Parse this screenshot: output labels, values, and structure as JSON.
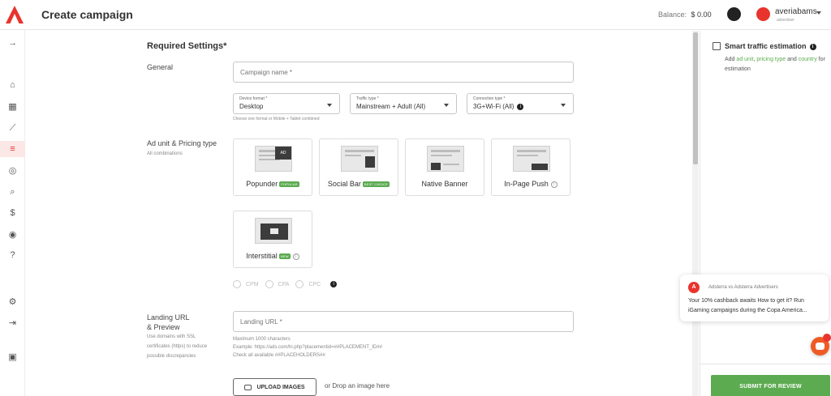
{
  "header": {
    "title": "Create campaign",
    "balance_label": "Balance:",
    "balance_value": "$ 0.00",
    "username": "averiabams",
    "user_role": "advertiser"
  },
  "sidebar": {
    "items": [
      {
        "name": "expand",
        "glyph": "→"
      },
      {
        "name": "academy",
        "glyph": "⌂"
      },
      {
        "name": "dashboard",
        "glyph": "▦"
      },
      {
        "name": "statistics",
        "glyph": "⟋"
      },
      {
        "name": "campaigns",
        "glyph": "≡"
      },
      {
        "name": "explore",
        "glyph": "◎"
      },
      {
        "name": "search",
        "glyph": "⌕"
      },
      {
        "name": "finance",
        "glyph": "$"
      },
      {
        "name": "referral",
        "glyph": "◉"
      },
      {
        "name": "help",
        "glyph": "?"
      },
      {
        "name": "settings",
        "glyph": "⚙"
      },
      {
        "name": "logout",
        "glyph": "⇥"
      },
      {
        "name": "wallet",
        "glyph": "▣"
      }
    ]
  },
  "form": {
    "section_title": "Required Settings*",
    "general_label": "General",
    "campaign_name_placeholder": "Campaign name *",
    "device_format": {
      "label": "Device format *",
      "value": "Desktop"
    },
    "traffic_type": {
      "label": "Traffic type *",
      "value": "Mainstream + Adult (All)"
    },
    "connection_type": {
      "label": "Connection type *",
      "value": "3G+Wi-Fi (All)"
    },
    "device_hint": "Choose one format or Mobile + Tablet combined",
    "ad_unit_label": "Ad unit & Pricing type",
    "ad_unit_sub": "All combinations",
    "ad_units": [
      {
        "name": "Popunder",
        "badge": "POPULAR"
      },
      {
        "name": "Social Bar",
        "badge": "BEST CHOICE"
      },
      {
        "name": "Native Banner",
        "badge": ""
      },
      {
        "name": "In-Page Push",
        "badge": ""
      },
      {
        "name": "Interstitial",
        "badge": "NEW"
      }
    ],
    "thumb_label": "AD",
    "pricing": [
      "CPM",
      "CPA",
      "CPC"
    ],
    "landing_label_1": "Landing URL",
    "landing_label_2": "& Preview",
    "landing_sub": "Use domains with SSL certificates (https) to reduce possible discrepancies",
    "landing_placeholder": "Landing URL *",
    "landing_hint_1": "Maximum 1000 characters",
    "landing_hint_2": "Example: https://ads.com/ln.php?placementid=##PLACEMENT_ID##",
    "landing_hint_3": "Check all available ##PLACEHOLDERS##",
    "upload_label": "UPLOAD IMAGES",
    "drop_text": "or Drop an image here"
  },
  "right_panel": {
    "title": "Smart traffic estimation",
    "desc_add": "Add",
    "link_ad_unit": "ad unit",
    "link_pricing": "pricing type",
    "desc_and": "and",
    "link_country": "country",
    "desc_end": "for estimation",
    "submit_label": "SUBMIT FOR REVIEW"
  },
  "chat": {
    "avatar_letter": "A",
    "from": "Adsterra vs Adsterra Advertisers",
    "message": "Your 10% cashback awaits How to get it? Run iGaming campaigns during the Copa America..."
  },
  "colors": {
    "brand": "#e8342c",
    "accent_green": "#5cab50",
    "chat_launcher": "#ef5b25"
  }
}
